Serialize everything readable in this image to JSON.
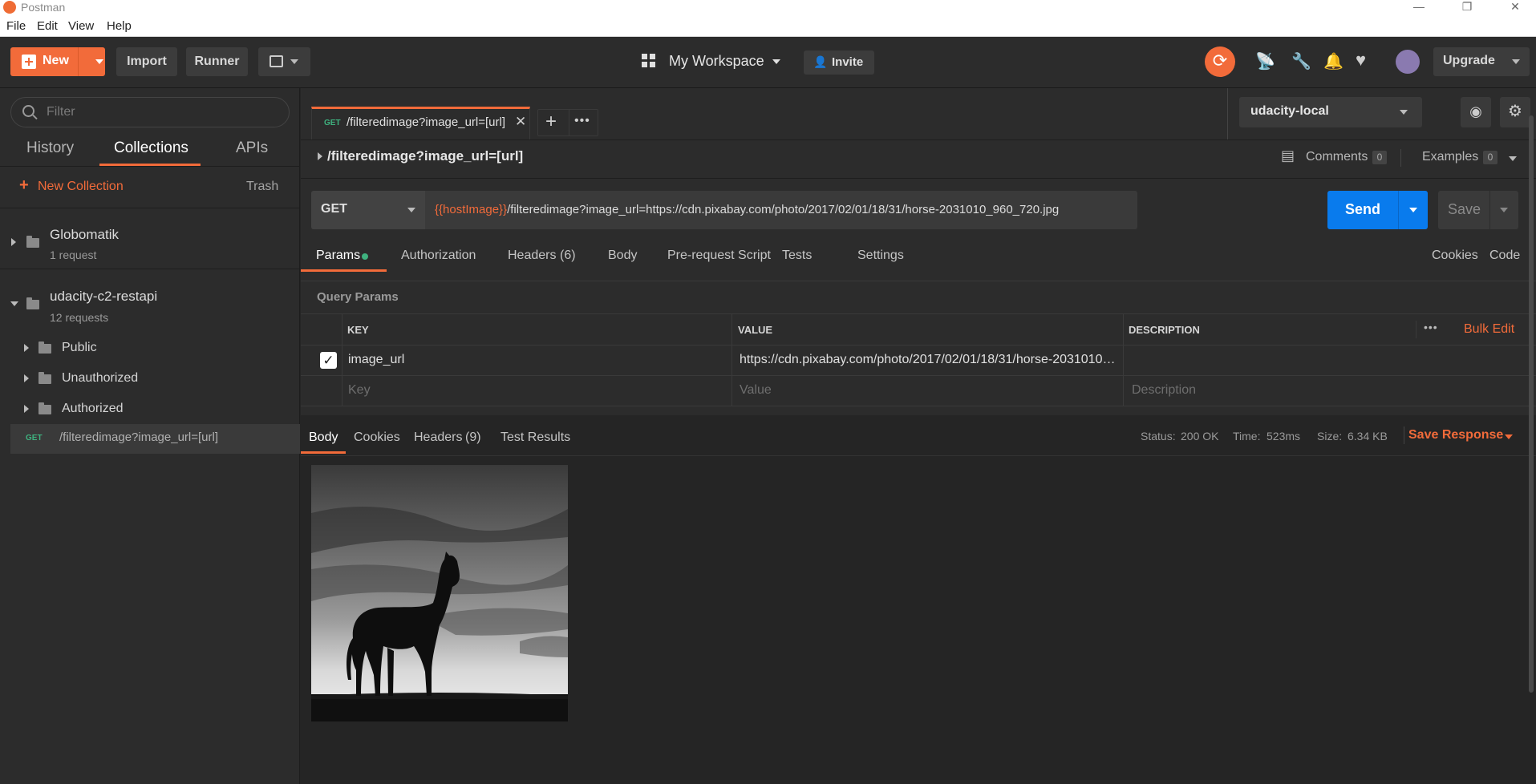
{
  "window": {
    "title": "Postman",
    "minimize": "—",
    "maximize": "❐",
    "close": "✕"
  },
  "menu": [
    "File",
    "Edit",
    "View",
    "Help"
  ],
  "toolbar": {
    "new_label": "New",
    "import_label": "Import",
    "runner_label": "Runner",
    "workspace_label": "My Workspace",
    "invite_label": "Invite",
    "upgrade_label": "Upgrade"
  },
  "sidebar": {
    "filter_placeholder": "Filter",
    "tabs": [
      "History",
      "Collections",
      "APIs"
    ],
    "new_collection_label": "New Collection",
    "trash_label": "Trash",
    "collections": [
      {
        "name": "Globomatik",
        "count": "1 request"
      },
      {
        "name": "udacity-c2-restapi",
        "count": "12 requests"
      }
    ],
    "folders": [
      "Public",
      "Unauthorized",
      "Authorized"
    ],
    "request": {
      "method": "GET",
      "name": "/filteredimage?image_url=[url]"
    }
  },
  "request_tab": {
    "method": "GET",
    "name": "/filteredimage?image_url=[url]"
  },
  "environment": {
    "selected": "udacity-local"
  },
  "request": {
    "title": "/filteredimage?image_url=[url]",
    "comments_label": "Comments",
    "comments_count": "0",
    "examples_label": "Examples",
    "examples_count": "0",
    "method": "GET",
    "url_var": "{{hostImage}}",
    "url_rest": "/filteredimage?image_url=https://cdn.pixabay.com/photo/2017/02/01/18/31/horse-2031010_960_720.jpg",
    "send_label": "Send",
    "save_label": "Save"
  },
  "req_tabs": {
    "params": "Params",
    "authorization": "Authorization",
    "headers": "Headers",
    "headers_count": "(6)",
    "body": "Body",
    "prerequest": "Pre-request Script",
    "tests": "Tests",
    "settings": "Settings",
    "cookies": "Cookies",
    "code": "Code"
  },
  "params": {
    "section_title": "Query Params",
    "columns": [
      "KEY",
      "VALUE",
      "DESCRIPTION"
    ],
    "bulk_edit": "Bulk Edit",
    "row": {
      "key": "image_url",
      "value": "https://cdn.pixabay.com/photo/2017/02/01/18/31/horse-2031010…",
      "checked": true
    },
    "placeholders": {
      "key": "Key",
      "value": "Value",
      "description": "Description"
    }
  },
  "response": {
    "tabs": {
      "body": "Body",
      "cookies": "Cookies",
      "headers": "Headers",
      "headers_count": "(9)",
      "tests": "Test Results"
    },
    "status_label": "Status:",
    "status_value": "200 OK",
    "time_label": "Time:",
    "time_value": "523ms",
    "size_label": "Size:",
    "size_value": "6.34 KB",
    "save_response": "Save Response"
  },
  "colors": {
    "accent": "#f26b3a",
    "send": "#097bed",
    "success": "#3fb27f"
  }
}
